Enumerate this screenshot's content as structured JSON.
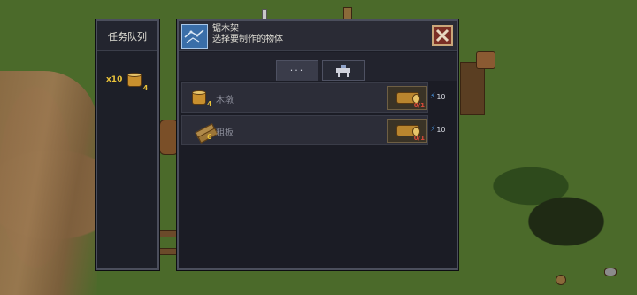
{
  "queue": {
    "title": "任务队列",
    "item": {
      "multiplier": "x10",
      "icon": "log-stump-icon",
      "quantity": "4"
    }
  },
  "craft": {
    "title": "锯木架",
    "subtitle": "选择要制作的物体",
    "icon": "blueprint-icon",
    "close_icon": "close-icon",
    "tabs": [
      {
        "label": "···",
        "icon": "dots-icon",
        "active": true
      },
      {
        "label": "",
        "icon": "crafting-table-icon",
        "active": false
      }
    ],
    "recipes": [
      {
        "name": "木墩",
        "quantity": "4",
        "icon": "log-stump-icon",
        "resource_icon": "log-icon",
        "resource_count": "0/1",
        "energy": "10"
      },
      {
        "name": "粗板",
        "quantity": "6",
        "icon": "planks-icon",
        "resource_icon": "log-icon",
        "resource_count": "0/1",
        "energy": "10"
      }
    ]
  },
  "colors": {
    "accent": "#e8c23a",
    "panel": "#1b1c25",
    "close": "#7a2f25",
    "energy": "#4a9ae8"
  }
}
